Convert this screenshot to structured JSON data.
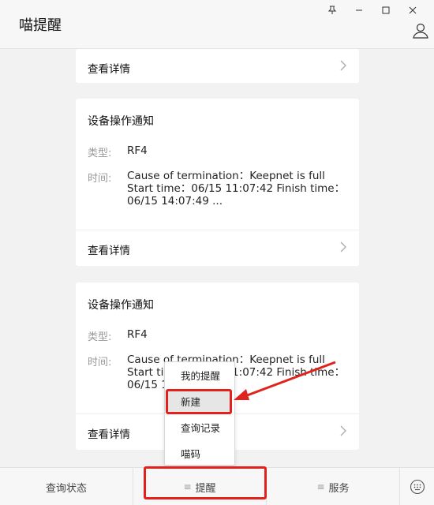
{
  "app": {
    "title": "喵提醒"
  },
  "window_controls": [
    "pin-icon",
    "minimize-icon",
    "maximize-icon",
    "close-icon"
  ],
  "cards": [
    {
      "detail_label": "查看详情"
    },
    {
      "title": "设备操作通知",
      "type_label": "类型:",
      "type_value": "RF4",
      "time_label": "时间:",
      "time_lines": [
        "Cause of termination：Keepnet is full",
        "Start time：06/15 11:07:42 Finish time：",
        "06/15 14:07:49 ..."
      ],
      "detail_label": "查看详情"
    },
    {
      "title": "设备操作通知",
      "type_label": "类型:",
      "type_value": "RF4",
      "time_label": "时间:",
      "time_lines": [
        "Cause of termination：Keepnet is full",
        "Start time：06/15 11:07:42 Finish time：",
        "06/15 14:07:49 ..."
      ],
      "detail_label": "查看详情"
    }
  ],
  "popup_menu": {
    "items": [
      "我的提醒",
      "新建",
      "查询记录",
      "喵码"
    ],
    "active_index": 1
  },
  "bottom_nav": {
    "query_status": "查询状态",
    "remind": "提醒",
    "service": "服务",
    "menu_glyph": "≡"
  },
  "colors": {
    "annotation_red": "#e0211c",
    "card_bg": "#ffffff",
    "page_bg": "#f2f2f2"
  }
}
